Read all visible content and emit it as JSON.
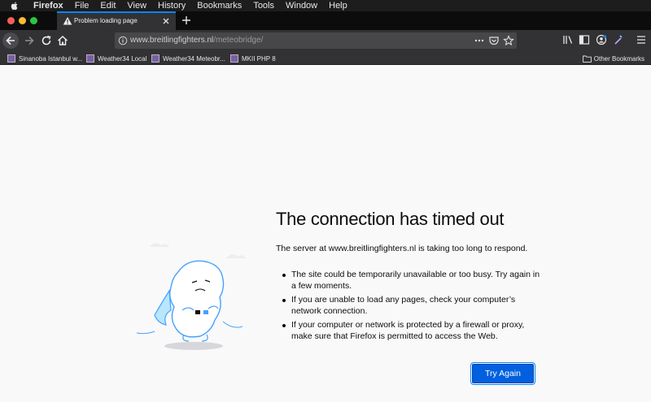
{
  "menubar": {
    "items": [
      "Firefox",
      "File",
      "Edit",
      "View",
      "History",
      "Bookmarks",
      "Tools",
      "Window",
      "Help"
    ]
  },
  "tab": {
    "title": "Problem loading page",
    "icon": "warning-icon"
  },
  "navbar": {
    "url_domain": "www.breitlingfighters.nl",
    "url_path": "/meteobridge/"
  },
  "bookmarks": {
    "items": [
      "Sinanoba Istanbul w...",
      "Weather34 Local",
      "Weather34 Meteobr...",
      "MKII PHP 8"
    ],
    "folder": "Other Bookmarks"
  },
  "error": {
    "title": "The connection has timed out",
    "description": "The server at www.breitlingfighters.nl is taking too long to respond.",
    "bullets": [
      "The site could be temporarily unavailable or too busy. Try again in a few moments.",
      "If you are unable to load any pages, check your computer’s network connection.",
      "If your computer or network is protected by a firewall or proxy, make sure that Firefox is permitted to access the Web."
    ],
    "button": "Try Again"
  },
  "colors": {
    "accent": "#0060df",
    "tab_highlight": "#0a84ff",
    "chrome_dark": "#323234",
    "page_bg": "#f9f9fa"
  }
}
